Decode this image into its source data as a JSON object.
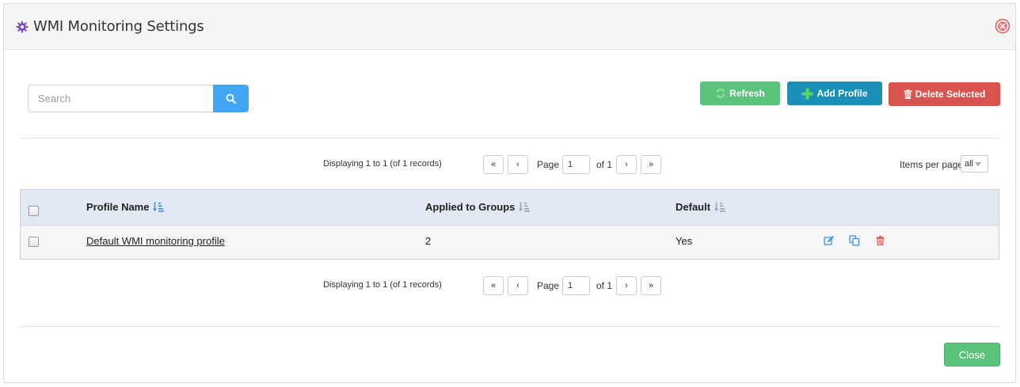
{
  "modal": {
    "title": "WMI Monitoring Settings",
    "icon": "gear-icon",
    "accent": "#7b4fc9"
  },
  "search": {
    "placeholder": "Search",
    "value": ""
  },
  "toolbar": {
    "refresh_label": "Refresh",
    "add_label": "Add Profile",
    "delete_label": "Delete Selected"
  },
  "pager": {
    "display_text": "Displaying 1 to 1 (of 1 records)",
    "page_label": "Page",
    "page_value": "1",
    "of_label": "of 1",
    "first": "«",
    "prev": "‹",
    "next": "›",
    "last": "»"
  },
  "items_per_page": {
    "label": "Items per page",
    "value": "all"
  },
  "table": {
    "columns": [
      "Profile Name",
      "Applied to Groups",
      "Default"
    ],
    "rows": [
      {
        "profile_name": "Default WMI monitoring profile",
        "applied_to_groups": "2",
        "default": "Yes"
      }
    ]
  },
  "footer": {
    "close_label": "Close"
  },
  "colors": {
    "primary_blue": "#42a5f5",
    "success_green": "#5cc47a",
    "info_teal": "#1b8fb8",
    "danger_red": "#d9534f"
  }
}
